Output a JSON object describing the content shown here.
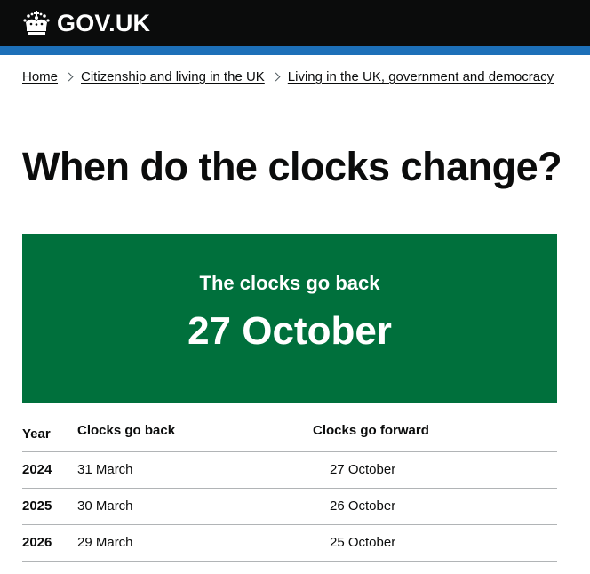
{
  "header": {
    "logo_text": "GOV.UK",
    "crown_icon": "crown-icon",
    "background_color": "#0b0c0c",
    "accent_bar_color": "#1d70b8"
  },
  "breadcrumb": {
    "items": [
      {
        "label": "Home"
      },
      {
        "label": "Citizenship and living in the UK"
      },
      {
        "label": "Living in the UK, government and democracy"
      }
    ]
  },
  "page": {
    "title": "When do the clocks change?"
  },
  "panel": {
    "label": "The clocks go back",
    "value": "27 October",
    "color": "#00703c"
  },
  "table": {
    "headers": {
      "year": "Year",
      "back": "Clocks go back",
      "forward": "Clocks go forward"
    },
    "rows": [
      {
        "year": "2024",
        "back": "31 March",
        "forward": "27 October"
      },
      {
        "year": "2025",
        "back": "30 March",
        "forward": "26 October"
      },
      {
        "year": "2026",
        "back": "29 March",
        "forward": "25 October"
      }
    ]
  }
}
